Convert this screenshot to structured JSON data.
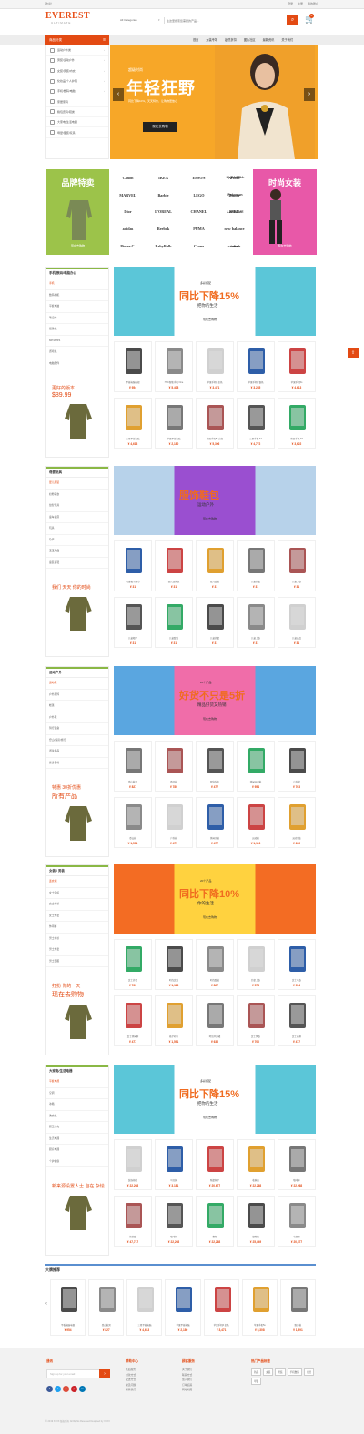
{
  "topbar": {
    "left": "欢迎！",
    "links": [
      "登录",
      "注册",
      "我的账户"
    ]
  },
  "header": {
    "logo_text": "EVEREST",
    "logo_sub": "ULTIMATE",
    "search_category": "All Categories",
    "search_placeholder": "在这里搜索您需要的产品...",
    "cart_count": "0"
  },
  "nav": {
    "categories_label": "商品分类",
    "links": [
      "首页",
      "女装专场",
      "超低折扣",
      "图片社区",
      "最新资讯",
      "关于我们"
    ]
  },
  "category_menu": [
    "运动户外类",
    "男装/运动户外",
    "女装/男装/内衣",
    "化妆品/个人护理",
    "手机/数码/电脑",
    "家居家具",
    "箱包皮具/鞋类",
    "大家电/生活电器",
    "母婴/童装/玩具"
  ],
  "hero": {
    "tagline": "超级时尚",
    "title": "年轻狂野",
    "desc": "同比下降10%，天天特价，让购物更放心",
    "cta": "现在去购物"
  },
  "brand_left": {
    "title": "品牌特卖",
    "more": "现在去购物"
  },
  "brand_right": {
    "title": "时尚女装",
    "more": "现在去购物"
  },
  "brands": [
    "Canon",
    "IKEA",
    "EPSON",
    "Artline",
    "DURACELL",
    "MARVEL",
    "Barbie",
    "LEGO",
    "Disney",
    "Pokemon",
    "Dior",
    "L'OREAL",
    "CHANEL",
    "NIKE",
    "LANCOME",
    "adidas",
    "Reebok",
    "PUMA",
    "new balance",
    "",
    "Pierre C.",
    "BabyBulb",
    "Crane",
    "carter's",
    "britax"
  ],
  "sections": [
    {
      "title": "手机/数码/电脑办公",
      "links": [
        "手机",
        "数码相机",
        "平板电脑",
        "笔记本",
        "摄像机",
        "MP3/MP4",
        "游戏机",
        "电脑配件"
      ],
      "promo_text": "更好的版本",
      "promo_price": "$89.99",
      "banner_small": "多彩搭配",
      "banner_title": "同比下降15%",
      "banner_sub": "把你的生活",
      "banner_cta": "现在去购物",
      "products": [
        {
          "name": "平板电脑电视",
          "price": "¥ 954"
        },
        {
          "name": "HTC智能手机 One",
          "price": "¥ 5,408"
        },
        {
          "name": "苹果手机6 金色",
          "price": "¥ 3,471"
        },
        {
          "name": "苹果手机6 银色",
          "price": "¥ 3,245"
        },
        {
          "name": "苹果手机5s",
          "price": "¥ 4,613"
        },
        {
          "name": "三星平板电脑",
          "price": "¥ 4,613"
        },
        {
          "name": "苹果平板电脑",
          "price": "¥ 2,180"
        },
        {
          "name": "苹果手机5s 白色",
          "price": "¥ 5,306"
        },
        {
          "name": "三星手机 S4",
          "price": "¥ 4,772"
        },
        {
          "name": "索尼手机 Z3",
          "price": "¥ 3,622"
        }
      ]
    },
    {
      "title": "母婴玩具",
      "links": [
        "婴儿服装",
        "奶粉辅食",
        "益智玩具",
        "童车童床",
        "玩具",
        "孕产",
        "宝宝用品",
        "童装童鞋"
      ],
      "promo_text": "我们 天天 你的时尚",
      "promo_price": "",
      "banner_small": "",
      "banner_title": "服饰鞋包",
      "banner_sub": "运动户外",
      "banner_cta": "现在去购物",
      "products": [
        {
          "name": "儿童帽子围巾",
          "price": "¥ 31"
        },
        {
          "name": "婴儿连体衣",
          "price": "¥ 31"
        },
        {
          "name": "婴儿套装",
          "price": "¥ 31"
        },
        {
          "name": "儿童外套",
          "price": "¥ 31"
        },
        {
          "name": "儿童卫衣",
          "price": "¥ 31"
        },
        {
          "name": "儿童帽子",
          "price": "¥ 31"
        },
        {
          "name": "儿童套装",
          "price": "¥ 31"
        },
        {
          "name": "儿童外套",
          "price": "¥ 31"
        },
        {
          "name": "儿童上衣",
          "price": "¥ 31"
        },
        {
          "name": "儿童床品",
          "price": "¥ 31"
        }
      ]
    },
    {
      "title": "运动户外",
      "links": [
        "运动鞋",
        "户外服饰",
        "帐篷",
        "户外鞋",
        "骑行装备",
        "登山/露营/旅行",
        "游泳用品",
        "健身器材"
      ],
      "promo_text": "特惠 30折优惠",
      "promo_price": "所有产品",
      "banner_small": "20个产品",
      "banner_title": "好货不只是5折",
      "banner_sub": "精品好货又热销",
      "banner_cta": "现在去购物",
      "products": [
        {
          "name": "登山鞋男",
          "price": "¥ 827"
        },
        {
          "name": "跑步鞋",
          "price": "¥ 780"
        },
        {
          "name": "双肩背包",
          "price": "¥ 477"
        },
        {
          "name": "休闲运动鞋",
          "price": "¥ 954"
        },
        {
          "name": "户外靴",
          "price": "¥ 763"
        },
        {
          "name": "登山鞋",
          "price": "¥ 1,591"
        },
        {
          "name": "户外鞋",
          "price": "¥ 477"
        },
        {
          "name": "休闲凉鞋",
          "price": "¥ 477"
        },
        {
          "name": "运动鞋",
          "price": "¥ 1,113"
        },
        {
          "name": "运动T恤",
          "price": "¥ 636"
        }
      ]
    },
    {
      "title": "女装 / 男装",
      "links": [
        "连衣裙",
        "女士针织",
        "女士衬衫",
        "女士外套",
        "休闲裤",
        "男士衬衫",
        "男士外套",
        "男士西服"
      ],
      "promo_text": "打扮 你的一天",
      "promo_price": "现在去购物",
      "banner_small": "20个产品",
      "banner_title": "同比下降10%",
      "banner_sub": "你的生活",
      "banner_cta": "现在去购物",
      "products": [
        {
          "name": "女士外套",
          "price": "¥ 763"
        },
        {
          "name": "时尚女装",
          "price": "¥ 1,113"
        },
        {
          "name": "时尚套装",
          "price": "¥ 827"
        },
        {
          "name": "针织上衣",
          "price": "¥ 573"
        },
        {
          "name": "女士毛衣",
          "price": "¥ 954"
        },
        {
          "name": "女士休闲裤",
          "price": "¥ 477"
        },
        {
          "name": "格子衬衫",
          "price": "¥ 1,591"
        },
        {
          "name": "时尚半身裙",
          "price": "¥ 636"
        },
        {
          "name": "女士风衣",
          "price": "¥ 700"
        },
        {
          "name": "女士长裤",
          "price": "¥ 477"
        }
      ]
    },
    {
      "title": "大家电/生活电器",
      "links": [
        "平板电视",
        "空调",
        "冰箱",
        "洗衣机",
        "厨卫大电",
        "生活电器",
        "厨房电器",
        "个护健康"
      ],
      "promo_text": "新来源设置人士 自在 杂烩",
      "promo_price": "",
      "banner_small": "多彩搭配",
      "banner_title": "同比下降15%",
      "banner_sub": "把你的生活",
      "banner_cta": "现在去购物",
      "products": [
        {
          "name": "装饰抱枕",
          "price": "¥ 22,268"
        },
        {
          "name": "马克杯",
          "price": "¥ 3,181"
        },
        {
          "name": "陶瓷杯子",
          "price": "¥ 20,677"
        },
        {
          "name": "收纳盒",
          "price": "¥ 22,268"
        },
        {
          "name": "咖啡杯",
          "price": "¥ 22,268"
        },
        {
          "name": "抱枕套",
          "price": "¥ 47,717"
        },
        {
          "name": "咖啡杯",
          "price": "¥ 22,268"
        },
        {
          "name": "靠垫",
          "price": "¥ 22,268"
        },
        {
          "name": "储物箱",
          "price": "¥ 25,449"
        },
        {
          "name": "电视柜",
          "price": "¥ 20,677"
        }
      ]
    }
  ],
  "featured": {
    "title": "大牌推荐",
    "products": [
      {
        "name": "平板电脑电视",
        "price": "¥ 954"
      },
      {
        "name": "登山鞋男",
        "price": "¥ 827"
      },
      {
        "name": "三星平板电脑",
        "price": "¥ 4,613"
      },
      {
        "name": "苹果平板电脑",
        "price": "¥ 2,180"
      },
      {
        "name": "苹果手机6 金色",
        "price": "¥ 3,471"
      },
      {
        "name": "苹果手机5s",
        "price": "¥ 5,308"
      },
      {
        "name": "跑步鞋",
        "price": "¥ 1,591"
      }
    ]
  },
  "footer": {
    "newsletter_title": "通讯",
    "newsletter_placeholder": "Sign up for your email",
    "col2_title": "帮助中心",
    "col2_links": [
      "售后服务",
      "付款方式",
      "配送方式",
      "常见问题",
      "联系我们"
    ],
    "col3_title": "顾客服务",
    "col3_links": [
      "关于我们",
      "联系方式",
      "加入我们",
      "订单追踪",
      "网站地图"
    ],
    "col4_title": "热门产品标签",
    "tags": [
      "新品",
      "女装",
      "男装",
      "手机数码",
      "家居",
      "母婴"
    ],
    "copyright": "© 2019 XXXX 版权所有  All Rights Reserved  Designed by XXXX"
  },
  "colors": {
    "accent": "#e34a13",
    "green": "#8ab845",
    "hero_bg": "#f7a728"
  }
}
